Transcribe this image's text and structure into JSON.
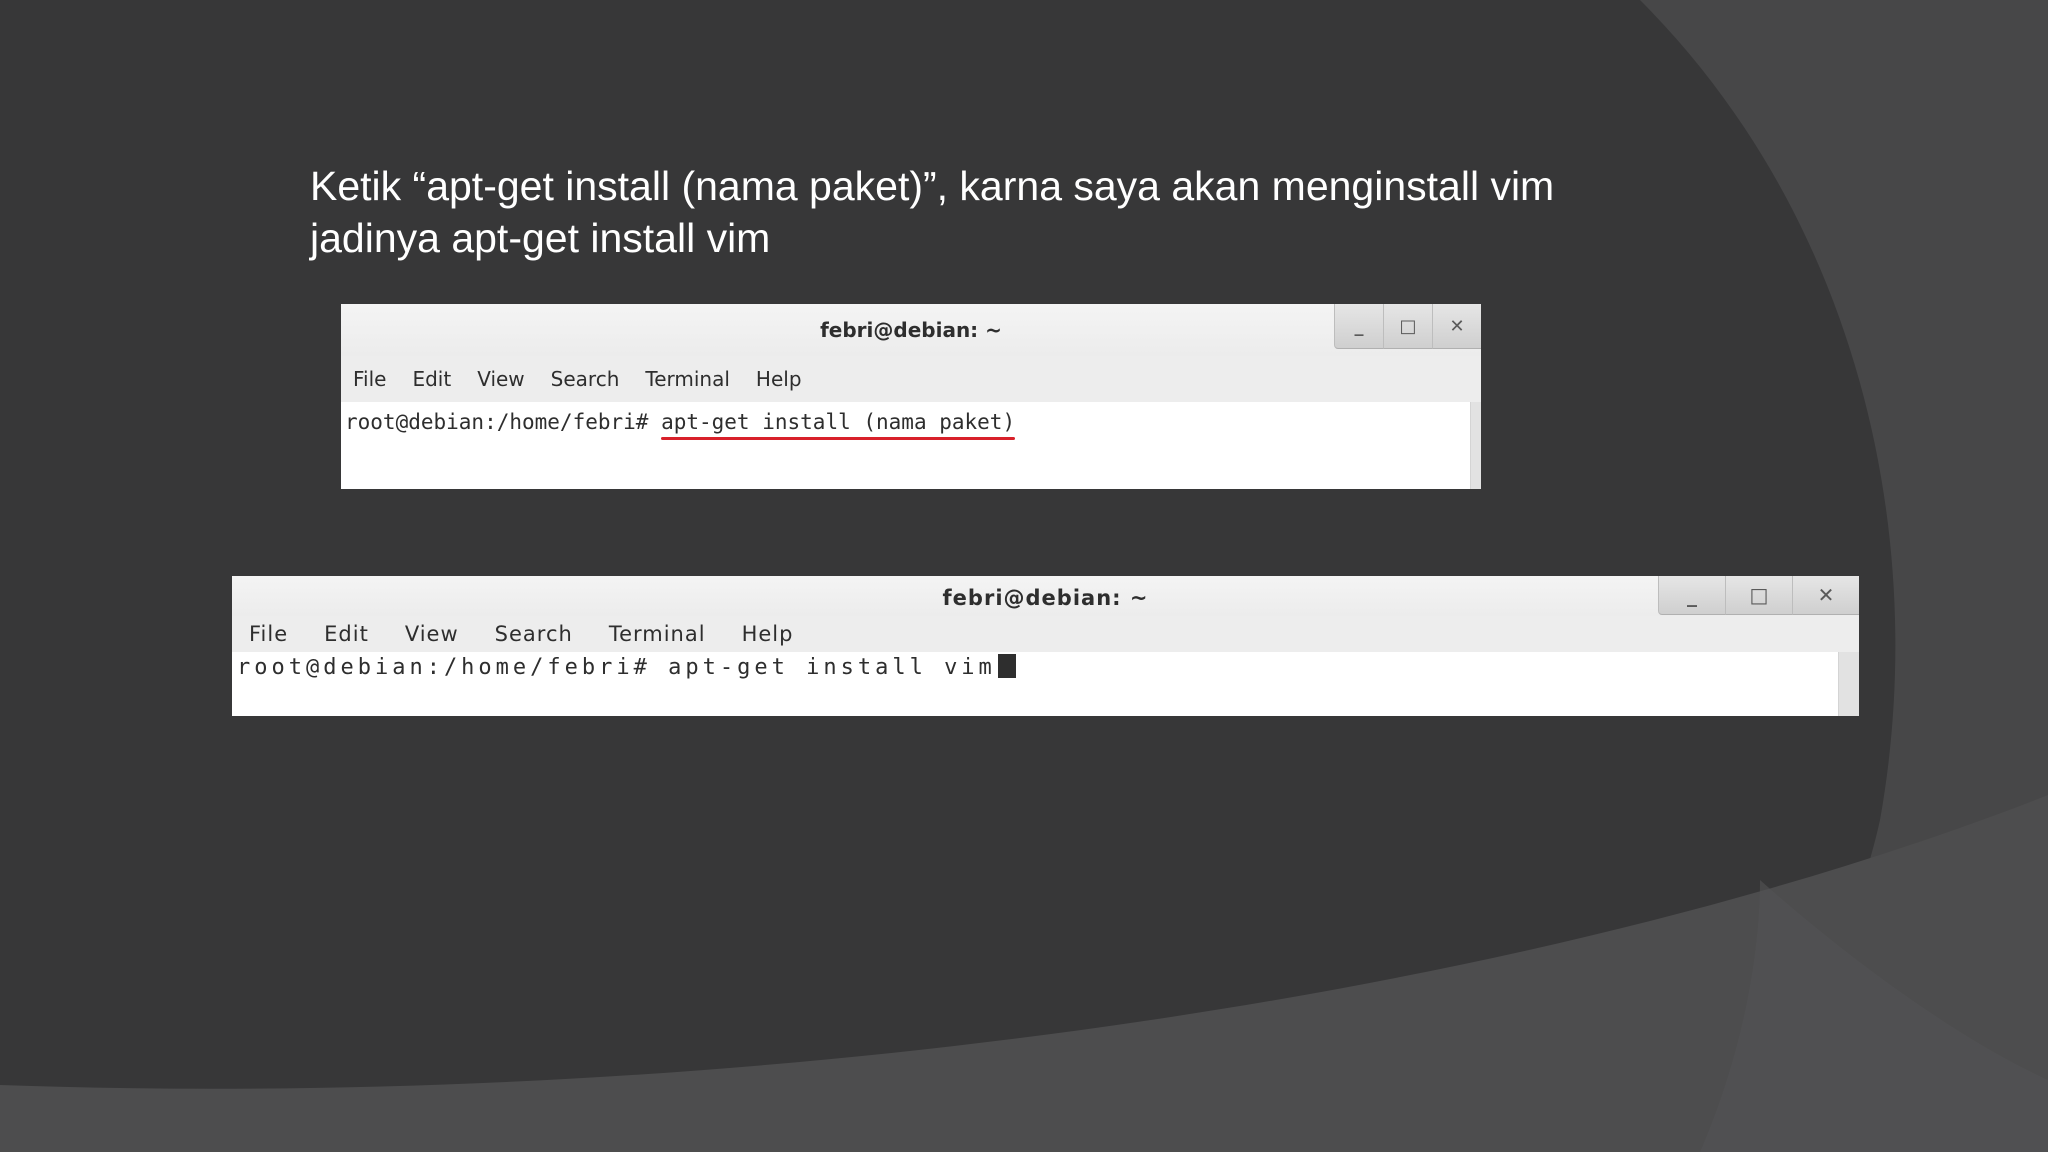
{
  "caption": {
    "line1": "Ketik “apt-get install (nama paket)”, karna saya akan menginstall vim",
    "line2": "jadinya apt-get install vim"
  },
  "terminal1": {
    "title": "febri@debian: ~",
    "menu": [
      "File",
      "Edit",
      "View",
      "Search",
      "Terminal",
      "Help"
    ],
    "prompt": "root@debian:/home/febri# ",
    "command": "apt-get install (nama paket)",
    "buttons": {
      "minimize": "_",
      "maximize": "□",
      "close": "✕"
    }
  },
  "terminal2": {
    "title": "febri@debian: ~",
    "menu": [
      "File",
      "Edit",
      "View",
      "Search",
      "Terminal",
      "Help"
    ],
    "prompt": "root@debian:/home/febri# ",
    "command": "apt-get install vim",
    "buttons": {
      "minimize": "_",
      "maximize": "□",
      "close": "✕"
    }
  },
  "colors": {
    "background": "#373738",
    "highlight_underline": "#d8202a"
  }
}
